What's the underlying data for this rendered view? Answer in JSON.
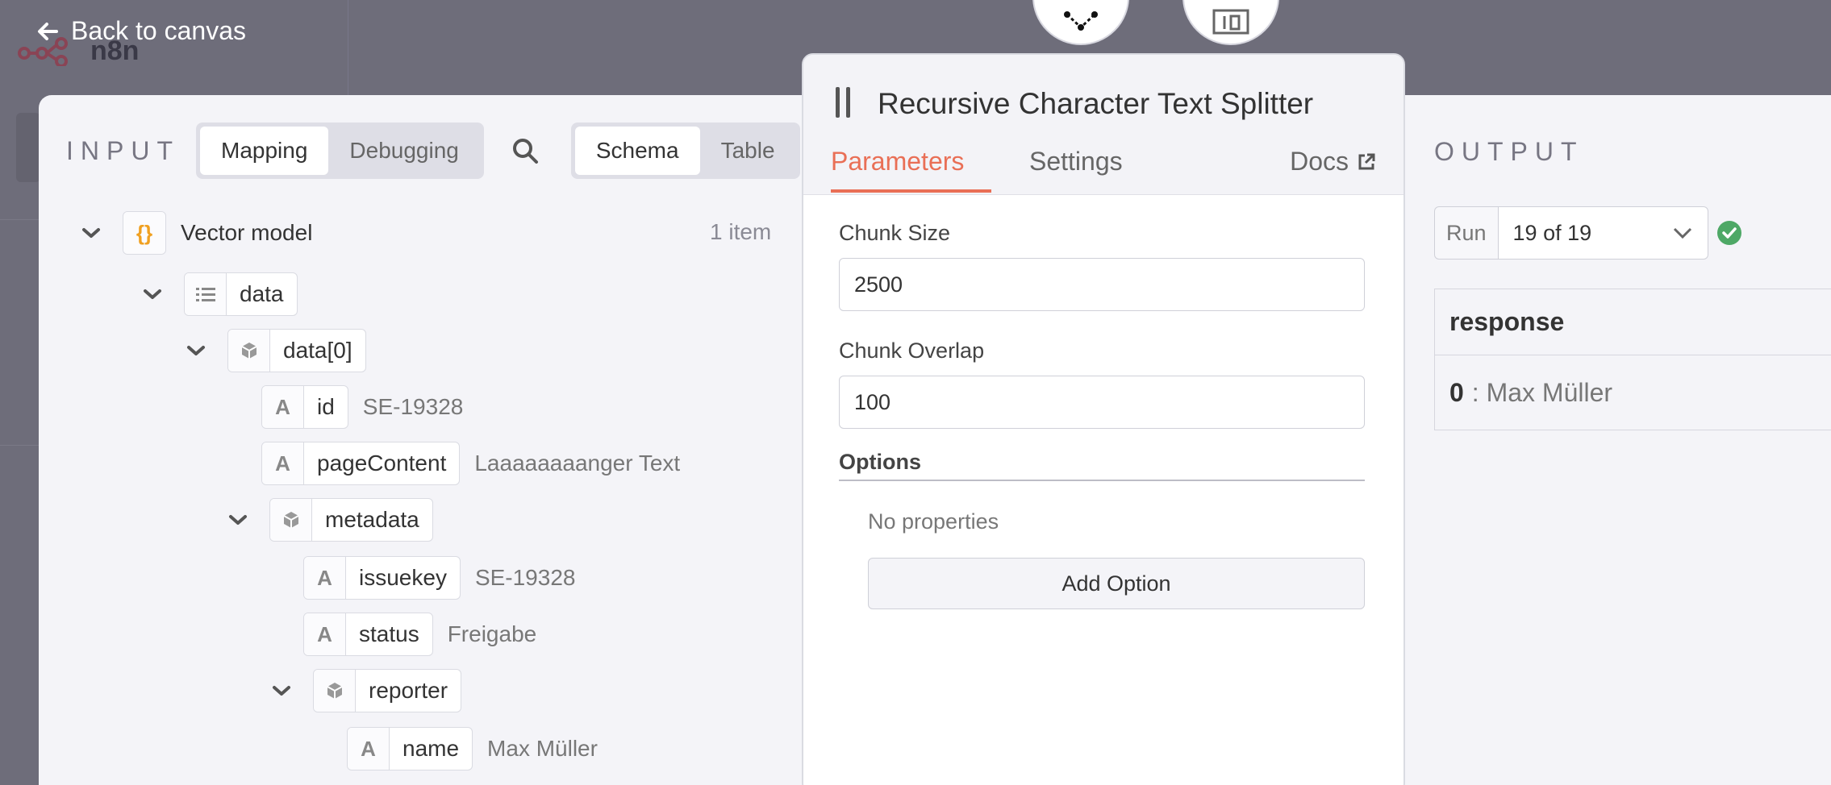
{
  "app": {
    "logo_text": "n8n",
    "back_label": "Back to canvas"
  },
  "input": {
    "label": "INPUT",
    "mode_tabs": [
      "Mapping",
      "Debugging"
    ],
    "view_tabs": [
      "Schema",
      "Table"
    ],
    "item_count": "1 item",
    "tree": {
      "root": "Vector model",
      "data": "data",
      "data0": "data[0]",
      "id_key": "id",
      "id_value": "SE-19328",
      "page_key": "pageContent",
      "page_value": "Laaaaaaaanger Text",
      "metadata": "metadata",
      "issuekey_key": "issuekey",
      "issuekey_value": "SE-19328",
      "status_key": "status",
      "status_value": "Freigabe",
      "reporter": "reporter",
      "name_key": "name",
      "name_value": "Max Müller"
    }
  },
  "node": {
    "title": "Recursive Character Text Splitter",
    "tabs": [
      "Parameters",
      "Settings"
    ],
    "docs_label": "Docs",
    "chunk_size_label": "Chunk Size",
    "chunk_size_value": "2500",
    "chunk_overlap_label": "Chunk Overlap",
    "chunk_overlap_value": "100",
    "options_label": "Options",
    "no_properties": "No properties",
    "add_option": "Add Option"
  },
  "output": {
    "label": "OUTPUT",
    "run_label": "Run",
    "run_value": "19 of 19",
    "column": "response",
    "row_index": "0",
    "row_value": ": Max Müller"
  },
  "colors": {
    "accent": "#e96f56",
    "success": "#4ea866",
    "panel_bg": "#f4f4f8",
    "backdrop": "#6e6d7a"
  }
}
